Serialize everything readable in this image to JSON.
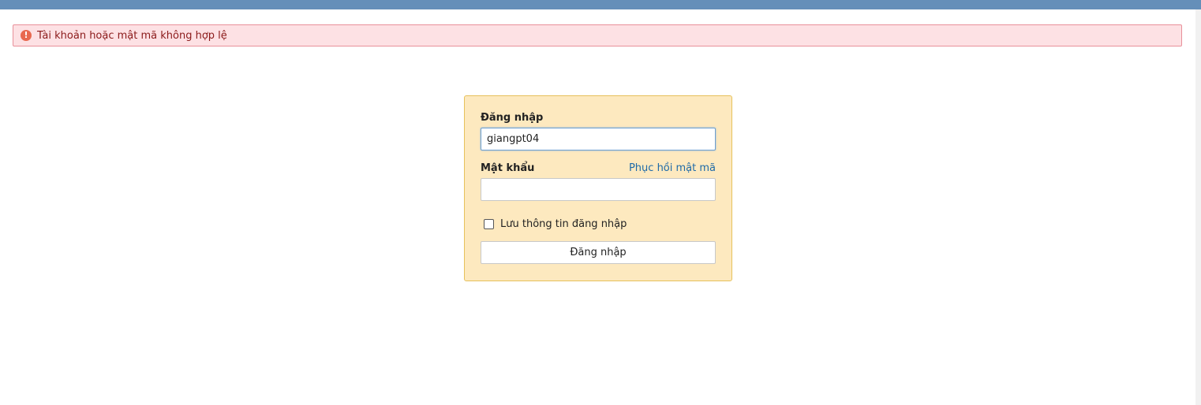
{
  "alert": {
    "icon": "exclamation-circle-icon",
    "message": "Tài khoản hoặc mật mã không hợp lệ"
  },
  "login": {
    "username_label": "Đăng nhập",
    "username_value": "giangpt04",
    "password_label": "Mật khẩu",
    "password_value": "",
    "recover_link": "Phục hồi mật mã",
    "remember_label": "Lưu thông tin đăng nhập",
    "remember_checked": false,
    "submit_label": "Đăng nhập"
  },
  "colors": {
    "header_bar": "#658fb9",
    "alert_bg": "#fde1e4",
    "alert_border": "#e8909a",
    "alert_text": "#8b1a1a",
    "login_bg": "#fde9bf",
    "login_border": "#e6c15c",
    "link": "#1e6aa8"
  }
}
